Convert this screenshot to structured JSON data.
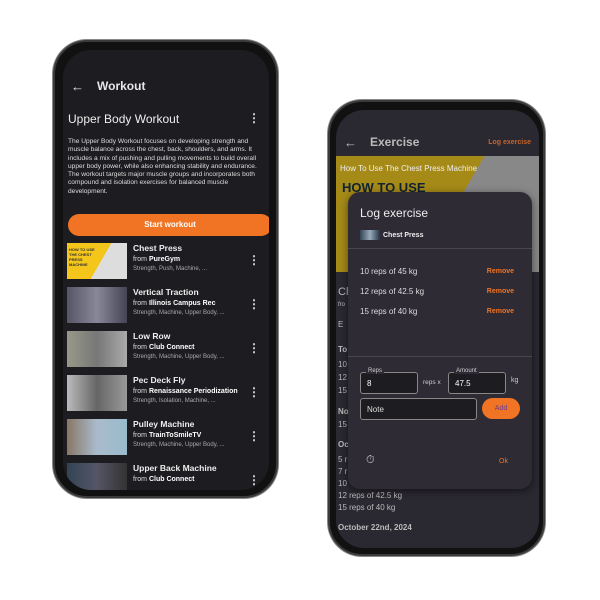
{
  "left_phone": {
    "appbar": {
      "title": "Workout"
    },
    "workout": {
      "title": "Upper Body Workout",
      "description": "The Upper Body Workout focuses on developing strength and muscle balance across the chest, back, shoulders, and arms. It includes a mix of pushing and pulling movements to build overall upper body power, while also enhancing stability and endurance. The workout targets major muscle groups and incorporates both compound and isolation exercises for balanced muscle development.",
      "start_label": "Start workout"
    },
    "thumb_caption": "HOW TO USE THE CHEST PRESS MACHINE",
    "exercises": [
      {
        "name": "Chest Press",
        "from": "from",
        "source": "PureGym",
        "tags": "Strength, Push, Machine, ..."
      },
      {
        "name": "Vertical Traction",
        "from": "from",
        "source": "Illinois Campus Rec",
        "tags": "Strength, Machine, Upper Body, ..."
      },
      {
        "name": "Low Row",
        "from": "from",
        "source": "Club Connect",
        "tags": "Strength, Machine, Upper Body, ..."
      },
      {
        "name": "Pec Deck Fly",
        "from": "from",
        "source": "Renaissance Periodization",
        "tags": "Strength, Isolation, Machine, ..."
      },
      {
        "name": "Pulley Machine",
        "from": "from",
        "source": "TrainToSmileTV",
        "tags": "Strength, Machine, Upper Body, ..."
      },
      {
        "name": "Upper Back Machine",
        "from": "from",
        "source": "Club Connect",
        "tags": ""
      }
    ]
  },
  "right_phone": {
    "appbar": {
      "title": "Exercise",
      "action": "Log exercise"
    },
    "video": {
      "title": "How To Use The Chest Press Machine",
      "overlay": "HOW TO USE"
    },
    "background_fragments": [
      "Ch",
      "fro",
      "E",
      "To",
      "10",
      "12",
      "15",
      "No",
      "15",
      "Oc",
      "5 r",
      "7 r",
      "10",
      "12 reps of 42.5 kg",
      "15 reps of 40 kg"
    ],
    "background_date": "October 22nd, 2024",
    "dialog": {
      "title": "Log exercise",
      "exercise": "Chest Press",
      "sets": [
        {
          "text": "10 reps of 45 kg",
          "action": "Remove"
        },
        {
          "text": "12 reps of 42.5 kg",
          "action": "Remove"
        },
        {
          "text": "15 reps of 40 kg",
          "action": "Remove"
        }
      ],
      "reps_label": "Reps",
      "reps_value": "8",
      "reps_unit": "reps x",
      "amount_label": "Amount",
      "amount_value": "47.5",
      "amount_unit": "kg",
      "note_placeholder": "Note",
      "add_label": "Add",
      "ok_label": "Ok"
    }
  },
  "colors": {
    "accent": "#f07424",
    "background": "#1d1c20",
    "dialog": "#2e2b35"
  }
}
